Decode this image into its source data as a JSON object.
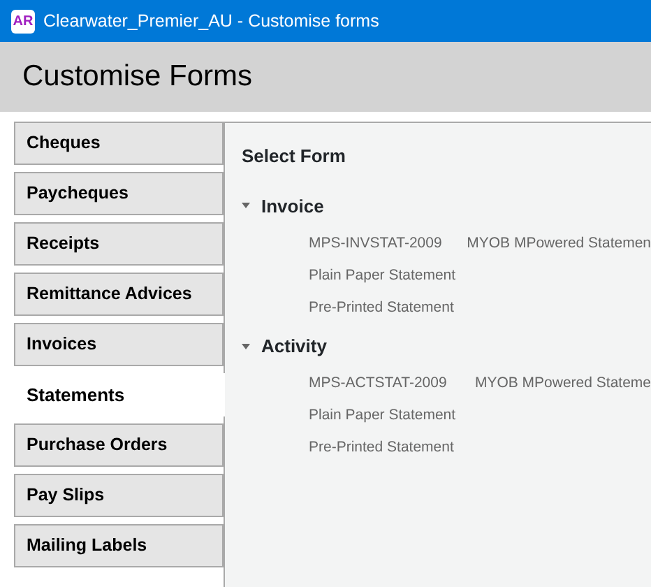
{
  "window": {
    "app_badge": "AR",
    "title": "Clearwater_Premier_AU - Customise forms"
  },
  "page_title": "Customise Forms",
  "tabs": [
    {
      "label": "Cheques",
      "selected": false
    },
    {
      "label": "Paycheques",
      "selected": false
    },
    {
      "label": "Receipts",
      "selected": false
    },
    {
      "label": "Remittance Advices",
      "selected": false
    },
    {
      "label": "Invoices",
      "selected": false
    },
    {
      "label": "Statements",
      "selected": true
    },
    {
      "label": "Purchase Orders",
      "selected": false
    },
    {
      "label": "Pay Slips",
      "selected": false
    },
    {
      "label": "Mailing Labels",
      "selected": false
    }
  ],
  "panel": {
    "heading": "Select Form",
    "groups": [
      {
        "name": "Invoice",
        "expanded": true,
        "forms": [
          {
            "name": "MPS-INVSTAT-2009",
            "description": "MYOB MPowered Statemen"
          },
          {
            "name": "Plain Paper Statement"
          },
          {
            "name": "Pre-Printed Statement"
          }
        ]
      },
      {
        "name": "Activity",
        "expanded": true,
        "forms": [
          {
            "name": "MPS-ACTSTAT-2009",
            "description": "MYOB MPowered Stateme"
          },
          {
            "name": "Plain Paper Statement"
          },
          {
            "name": "Pre-Printed Statement"
          }
        ]
      }
    ]
  }
}
